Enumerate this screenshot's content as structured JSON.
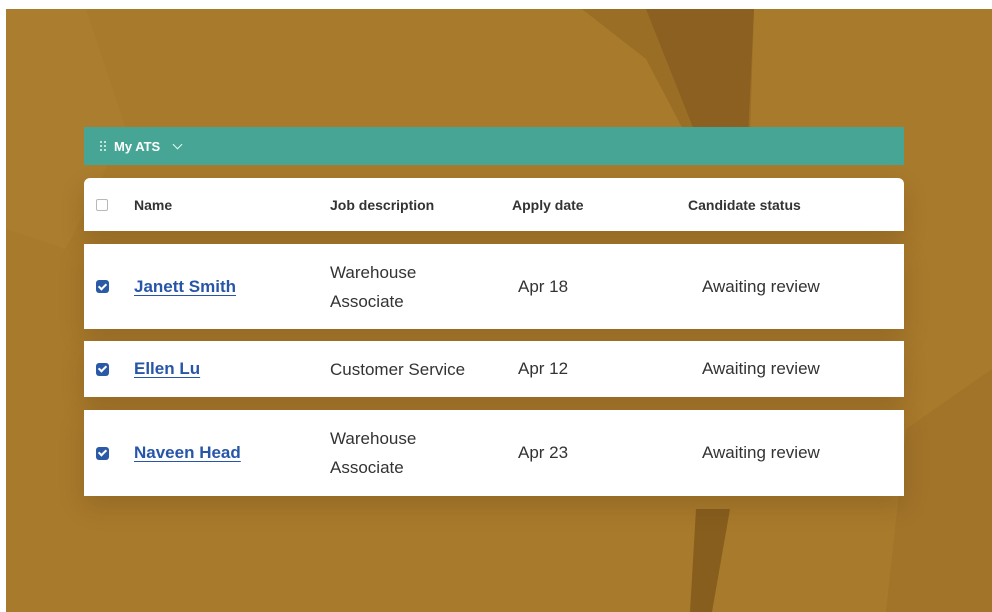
{
  "app": {
    "title": "My ATS"
  },
  "table": {
    "headers": {
      "name": "Name",
      "job": "Job description",
      "date": "Apply date",
      "status": "Candidate status"
    },
    "rows": [
      {
        "name": "Janett Smith",
        "job": "Warehouse Associate",
        "date": "Apr 18",
        "status": "Awaiting review",
        "checked": true
      },
      {
        "name": "Ellen Lu",
        "job": "Customer Service",
        "date": "Apr 12",
        "status": "Awaiting review",
        "checked": true
      },
      {
        "name": "Naveen Head",
        "job": "Warehouse Associate",
        "date": "Apr 23",
        "status": "Awaiting review",
        "checked": true
      }
    ]
  },
  "colors": {
    "background": "#a87a2c",
    "toolbar": "#46a594",
    "link": "#2756a8",
    "checkbox": "#2a5aa6"
  },
  "icons": {
    "toolbar_grip": "grip-icon",
    "toolbar_menu": "chevron-down-icon",
    "select_all": "checkbox-empty-icon",
    "row_select": "checkbox-checked-icon"
  }
}
